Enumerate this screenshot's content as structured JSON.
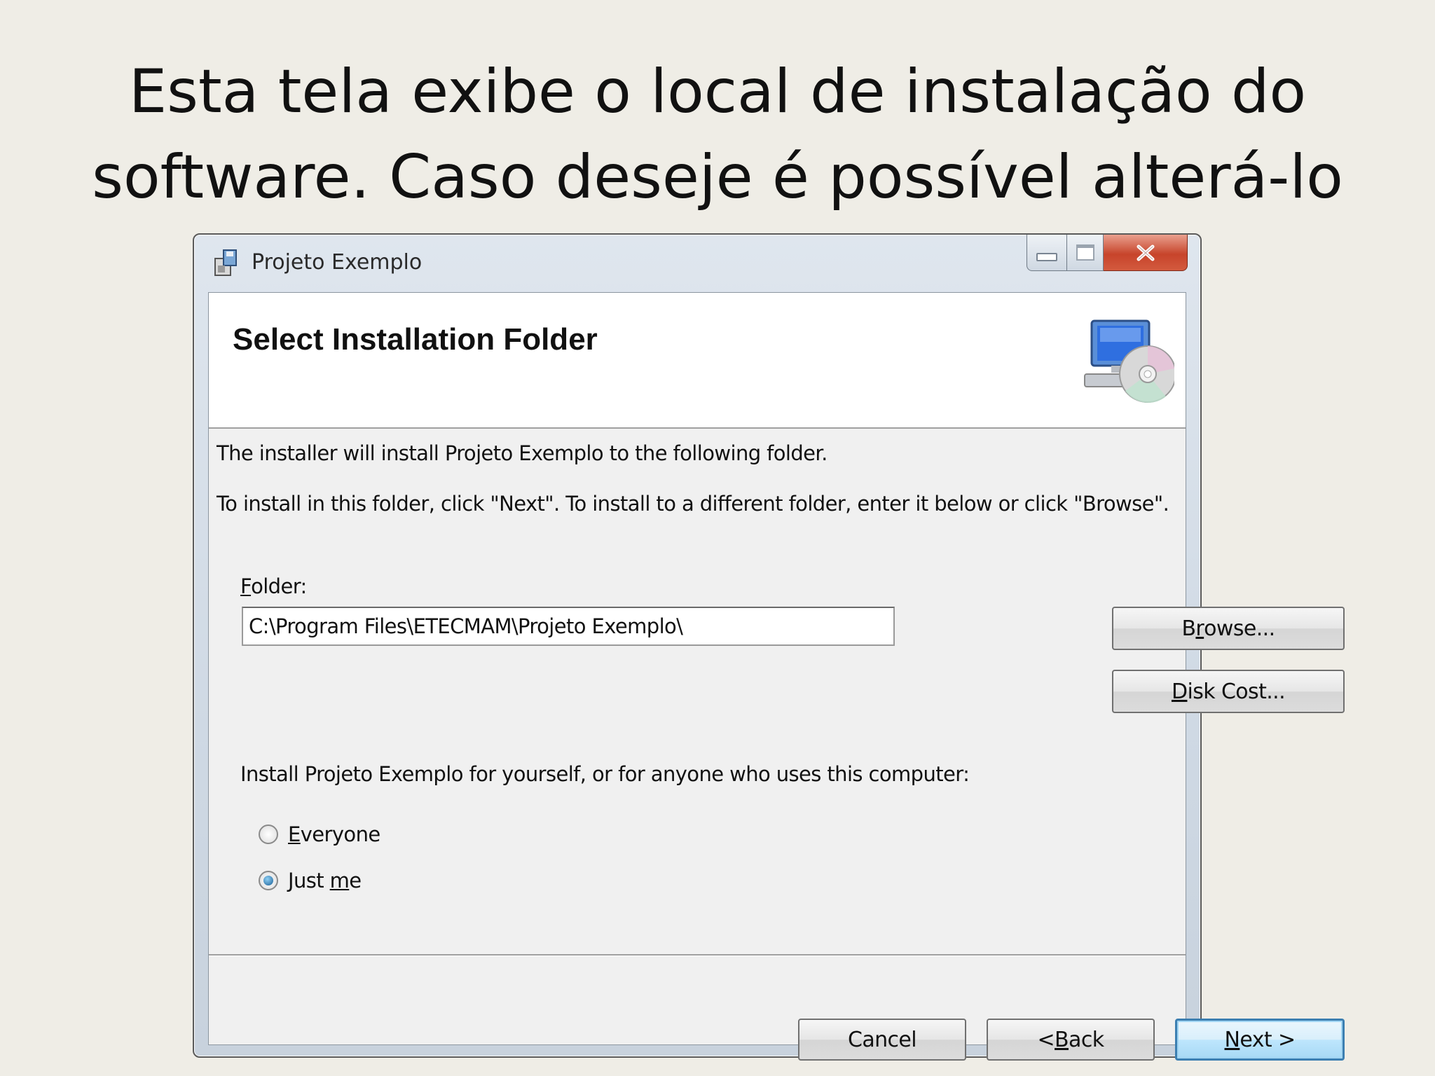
{
  "slide": {
    "title_line1": "Esta tela exibe o local de instalação do",
    "title_line2": "software. Caso deseje é possível alterá-lo"
  },
  "window": {
    "title": "Projeto Exemplo",
    "icon": "installer-package-icon",
    "caption_buttons": [
      "minimize-icon",
      "maximize-icon",
      "close-icon"
    ]
  },
  "banner": {
    "title": "Select Installation Folder",
    "icon": "computer-cd-icon"
  },
  "body": {
    "intro": "The installer will install Projeto Exemplo to the following folder.",
    "instructions": "To install in this folder, click \"Next\". To install to a different folder, enter it below or click \"Browse\".",
    "folder_label_accel": "F",
    "folder_label_rest": "older:",
    "folder_value": "C:\\Program Files\\ETECMAM\\Projeto Exemplo\\",
    "browse_pre": "B",
    "browse_accel": "r",
    "browse_post": "owse...",
    "disk_cost_accel": "D",
    "disk_cost_rest": "isk Cost...",
    "scope_prompt": "Install Projeto Exemplo for yourself, or for anyone who uses this computer:",
    "radio_everyone_accel": "E",
    "radio_everyone_rest": "veryone",
    "radio_justme_pre": "Just ",
    "radio_justme_accel": "m",
    "radio_justme_post": "e",
    "selected_option": "Just me"
  },
  "footer": {
    "cancel_label": "Cancel",
    "back_pre": "< ",
    "back_accel": "B",
    "back_post": "ack",
    "next_accel": "N",
    "next_post": "ext >"
  }
}
